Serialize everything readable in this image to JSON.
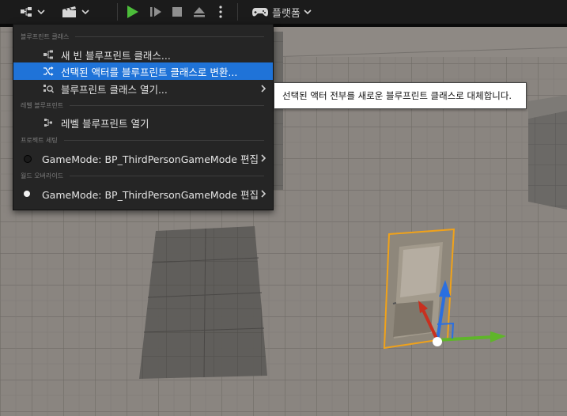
{
  "toolbar": {
    "platform_label": "플랫폼",
    "colors": {
      "play": "#4cbd3a",
      "bg": "#1b1b1b"
    },
    "icons": [
      "blueprint-icon",
      "chevron-down-icon",
      "cinematics-icon",
      "chevron-down-icon",
      "play-icon",
      "step-play-icon",
      "stop-icon",
      "eject-icon",
      "more-vertical-icon",
      "gamepad-icon",
      "chevron-down-icon"
    ]
  },
  "menu": {
    "section_blueprint_class": "블루프린트 클래스",
    "new_empty_blueprint": "새 빈 블루프린트 클래스...",
    "convert_selected": "선택된 액터를 블루프린트 클래스로 변환...",
    "open_blueprint_class": "블루프린트 클래스 열기...",
    "section_level_blueprint": "레벨 블루프린트",
    "open_level_blueprint": "레벨 블루프린트 열기",
    "section_project_settings": "프로젝트 세팅",
    "project_gamemode": "GameMode: BP_ThirdPersonGameMode 편집",
    "section_world_override": "월드 오버라이드",
    "world_gamemode": "GameMode: BP_ThirdPersonGameMode 편집",
    "highlight_color": "#1f73d8"
  },
  "tooltip": {
    "text": "선택된 액터 전부를 새로운 블루프린트 클래스로 대체합니다."
  }
}
